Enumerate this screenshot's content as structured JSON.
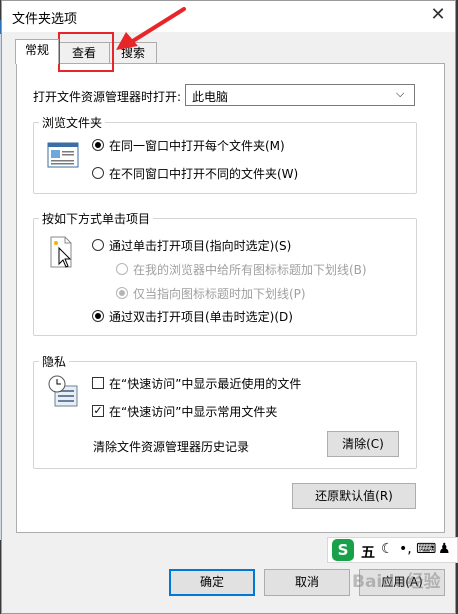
{
  "window": {
    "title": "文件夹选项"
  },
  "tabs": [
    {
      "label": "常规"
    },
    {
      "label": "查看"
    },
    {
      "label": "搜索"
    }
  ],
  "general": {
    "open_explorer_label": "打开文件资源管理器时打开:",
    "open_explorer_value": "此电脑",
    "browse_folders": {
      "title": "浏览文件夹",
      "option_same": "在同一窗口中打开每个文件夹(M)",
      "option_new": "在不同窗口中打开不同的文件夹(W)"
    },
    "click_items": {
      "title": "按如下方式单击项目",
      "single_click": "通过单击打开项目(指向时选定)(S)",
      "underline_all": "在我的浏览器中给所有图标标题加下划线(B)",
      "underline_point": "仅当指向图标标题时加下划线(P)",
      "double_click": "通过双击打开项目(单击时选定)(D)"
    },
    "privacy": {
      "title": "隐私",
      "show_recent": "在“快速访问”中显示最近使用的文件",
      "show_frequent": "在“快速访问”中显示常用文件夹",
      "clear_label": "清除文件资源管理器历史记录",
      "clear_button": "清除(C)"
    },
    "restore_defaults": "还原默认值(R)"
  },
  "footer": {
    "ok": "确定",
    "cancel": "取消",
    "apply": "应用(A)"
  },
  "ime": {
    "label": "五",
    "logo": "S"
  },
  "watermark": "Baidu经验",
  "colors": {
    "annotation": "#e8262a",
    "accent": "#0078d7",
    "ime_green": "#17a24a"
  }
}
